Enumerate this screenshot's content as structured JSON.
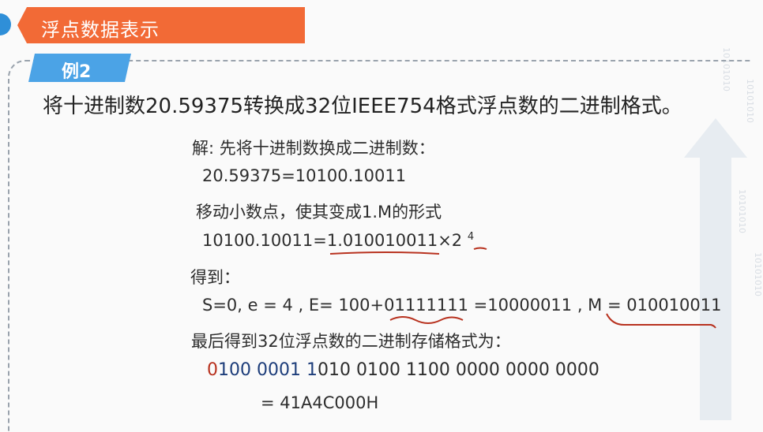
{
  "header": {
    "title": "浮点数据表示"
  },
  "example": {
    "tag": "例2"
  },
  "problem": {
    "text": "将十进制数20.59375转换成32位IEEE754格式浮点数的二进制格式。"
  },
  "solution": {
    "intro": "解: 先将十进制数换成二进制数：",
    "binary_eq": "20.59375=10100.10011",
    "move_point": "移动小数点，使其变成1.M的形式",
    "normalized": {
      "lhs": "10100.10011=",
      "mantissa": "1.010010011",
      "times": "×2",
      "exponent": "4"
    },
    "got": "得到：",
    "fields": "S=0, e = 4 , E= 100+01111111 =10000011 , M = 010010011",
    "final_intro": "最后得到32位浮点数的二进制存储格式为：",
    "bits": {
      "sign": "0",
      "exp_a": "100 0001 1",
      "rest": "010 0100 1100 0000 0000 0000"
    },
    "hex": "= 41A4C000H"
  },
  "colors": {
    "banner": "#f26a36",
    "tag": "#4ba3e6",
    "sign_bit": "#b8321f",
    "exponent_bits": "#1d3d7a",
    "ink": "#b8321f"
  },
  "decoration": {
    "binary_text": "10101010"
  }
}
